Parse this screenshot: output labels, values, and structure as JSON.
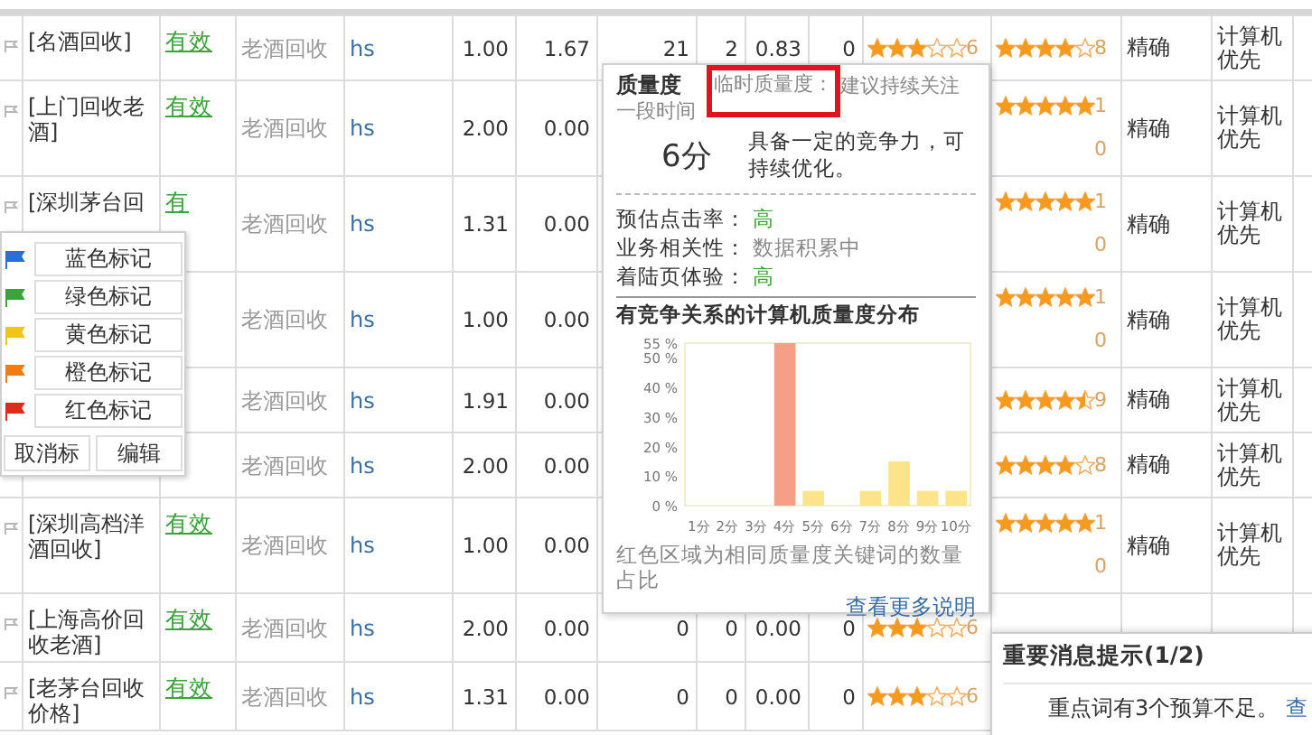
{
  "table": {
    "rows": [
      {
        "keyword": "[名酒回收]",
        "status": "有效",
        "plan": "老酒回收",
        "unit": "hs",
        "bid": "1.00",
        "column_6": "1.67",
        "column_7": "21",
        "column_8": "2",
        "column_9": "0.83",
        "column_10": "0",
        "quality": {
          "stars": 3,
          "score": "6"
        },
        "rating": {
          "stars": 4,
          "score": "8"
        },
        "match": "精确",
        "device": "计算机优先"
      },
      {
        "keyword": "[上门回收老酒]",
        "status": "有效",
        "plan": "老酒回收",
        "unit": "hs",
        "bid": "2.00",
        "column_6": "0.00",
        "rating": {
          "stars": 5,
          "score": "10"
        },
        "match": "精确",
        "device": "计算机优先"
      },
      {
        "keyword": "[深圳茅台回",
        "status": "有",
        "plan": "老酒回收",
        "unit": "hs",
        "bid": "1.31",
        "column_6": "0.00",
        "rating": {
          "stars": 5,
          "score": "10"
        },
        "match": "精确",
        "device": "计算机优先"
      },
      {
        "plan": "老酒回收",
        "unit": "hs",
        "bid": "1.00",
        "column_6": "0.00",
        "rating": {
          "stars": 5,
          "score": "10"
        },
        "match": "精确",
        "device": "计算机优先"
      },
      {
        "plan": "老酒回收",
        "unit": "hs",
        "bid": "1.91",
        "column_6": "0.00",
        "rating": {
          "stars": 4.5,
          "score": "9"
        },
        "match": "精确",
        "device": "计算机优先"
      },
      {
        "plan": "老酒回收",
        "unit": "hs",
        "bid": "2.00",
        "column_6": "0.00",
        "rating": {
          "stars": 4,
          "score": "8"
        },
        "match": "精确",
        "device": "计算机优先"
      },
      {
        "keyword": "[深圳高档洋酒回收]",
        "status": "有效",
        "plan": "老酒回收",
        "unit": "hs",
        "bid": "1.00",
        "column_6": "0.00",
        "rating": {
          "stars": 5,
          "score": "10"
        },
        "match": "精确",
        "device": "计算机优先"
      },
      {
        "keyword": "[上海高价回收老酒]",
        "status": "有效",
        "plan": "老酒回收",
        "unit": "hs",
        "bid": "2.00",
        "column_6": "0.00",
        "column_7": "0",
        "column_8": "0",
        "column_9": "0.00",
        "column_10": "0",
        "quality": {
          "stars": 3,
          "score": "6"
        }
      },
      {
        "keyword": "[老茅台回收价格]",
        "status": "有效",
        "plan": "老酒回收",
        "unit": "hs",
        "bid": "1.31",
        "column_6": "0.00",
        "column_7": "0",
        "column_8": "0",
        "column_9": "0.00",
        "column_10": "0",
        "quality": {
          "stars": 3,
          "score": "6"
        }
      }
    ]
  },
  "mark_menu": {
    "items": [
      {
        "label": "蓝色标记",
        "color": "#2a6fd6"
      },
      {
        "label": "绿色标记",
        "color": "#3aa33a"
      },
      {
        "label": "黄色标记",
        "color": "#f2c418"
      },
      {
        "label": "橙色标记",
        "color": "#f07c12"
      },
      {
        "label": "红色标记",
        "color": "#e02a1c"
      }
    ],
    "actions": [
      "取消标",
      "编辑"
    ]
  },
  "quality_popup": {
    "title": "质量度",
    "temporary_label": "临时质量度：",
    "temporary": "建议持续关注",
    "period": "一段时间",
    "score": "6分",
    "summary": "具备一定的竞争力，可持续优化。",
    "factors": [
      {
        "label": "预估点击率：",
        "value": "高",
        "kind": "good"
      },
      {
        "label": "业务相关性：",
        "value": "数据积累中",
        "kind": "pending"
      },
      {
        "label": "着陆页体验：",
        "value": "高",
        "kind": "good"
      }
    ],
    "distribution": {
      "title": "有竞争关系的计算机质量度分布",
      "chart_data": {
        "type": "bar",
        "stacked": true,
        "categories": [
          "1分",
          "2分",
          "3分",
          "4分",
          "5分",
          "6分",
          "7分",
          "8分",
          "9分",
          "10分"
        ],
        "series": [
          {
            "color": "#f79f86",
            "values": [
              null,
              null,
              null,
              55,
              null,
              null,
              null,
              null,
              null,
              null
            ]
          },
          {
            "color": "#fde38a",
            "values": [
              0,
              0,
              0,
              null,
              5,
              0,
              5,
              15,
              5,
              5
            ]
          }
        ],
        "ylim": [
          0,
          55
        ],
        "yticks": [
          {
            "value": 0,
            "label": "0 %"
          },
          {
            "value": 10,
            "label": "10 %"
          },
          {
            "value": 20,
            "label": "20 %"
          },
          {
            "value": 30,
            "label": "30 %"
          },
          {
            "value": 40,
            "label": "40 %"
          },
          {
            "value": 50,
            "label": "50 %"
          },
          {
            "value": 55,
            "label": "55 %"
          }
        ]
      },
      "caption": "红色区域为相同质量度关键词的数量占比",
      "link": "查看更多说明"
    }
  },
  "notice": {
    "title": "重要消息提示(1/2)",
    "message": "重点词有3个预算不足。",
    "link": "查"
  }
}
